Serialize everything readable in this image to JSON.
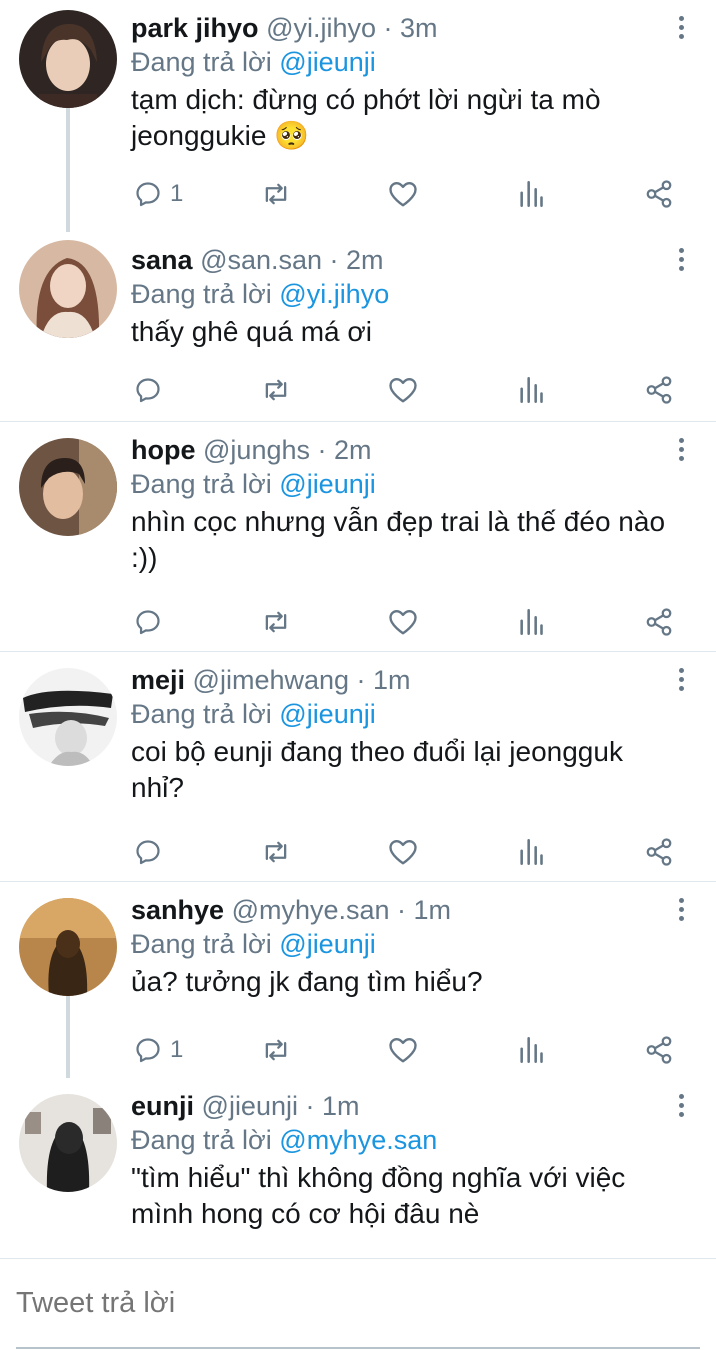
{
  "reply_prefix": "Đang trả lời",
  "tweets": [
    {
      "name": "park jihyo",
      "meta": "@yi.jihyo · 3m",
      "reply_to": "@jieunji",
      "text": "tạm dịch: đừng có phớt lời ngừi ta mò jeonggukie 🥺",
      "reply_count": "1",
      "avatar_color": "#3a2e28"
    },
    {
      "name": "sana",
      "meta": "@san.san · 2m",
      "reply_to": "@yi.jihyo",
      "text": "thấy ghê quá má ơi",
      "reply_count": "",
      "avatar_color": "#c9a58f"
    },
    {
      "name": "hope",
      "meta": "@junghs · 2m",
      "reply_to": "@jieunji",
      "text": "nhìn cọc nhưng vẫn đẹp trai là thế đéo nào :))",
      "reply_count": "",
      "avatar_color": "#5a4636"
    },
    {
      "name": "meji",
      "meta": "@jimehwang · 1m",
      "reply_to": "@jieunji",
      "text": "coi bộ eunji đang theo đuổi lại jeongguk nhỉ?",
      "reply_count": "",
      "avatar_color": "#e8e8e8"
    },
    {
      "name": "sanhye",
      "meta": "@myhye.san · 1m",
      "reply_to": "@jieunji",
      "text": "ủa? tưởng jk đang tìm hiểu?",
      "reply_count": "1",
      "avatar_color": "#7a5530"
    },
    {
      "name": "eunji",
      "meta": "@jieunji · 1m",
      "reply_to": "@myhye.san",
      "text": "\"tìm hiểu\" thì không đồng nghĩa với việc mình hong có cơ hội đâu nè",
      "reply_count": "",
      "avatar_color": "#3a3a3a"
    }
  ],
  "compose": {
    "placeholder": "Tweet trả lời"
  },
  "icons": [
    "reply-icon",
    "retweet-icon",
    "like-icon",
    "stats-icon",
    "share-icon",
    "more-icon"
  ],
  "colors": {
    "link": "#1b95e0",
    "meta": "#657786",
    "divider": "#e1e8ed"
  }
}
